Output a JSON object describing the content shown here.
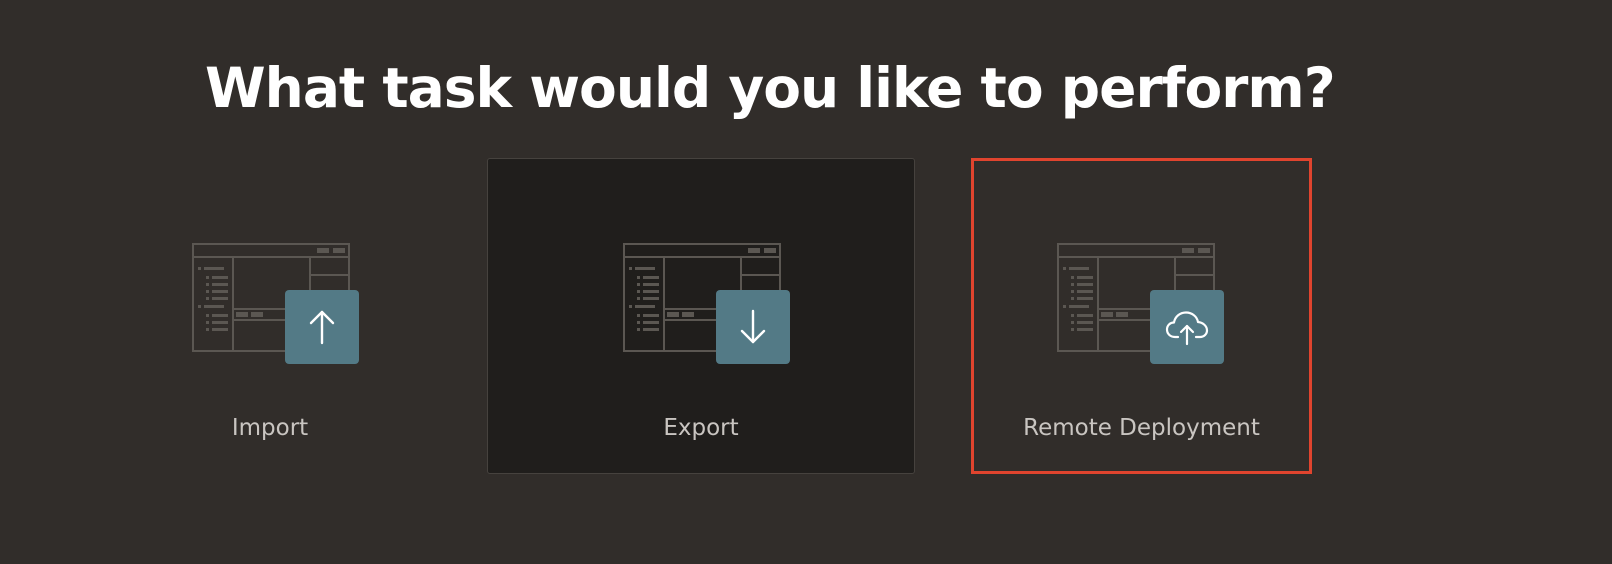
{
  "page": {
    "title": "What task would you like to perform?"
  },
  "tasks": [
    {
      "label": "Import",
      "icon": "upload-arrow-icon",
      "state": "default"
    },
    {
      "label": "Export",
      "icon": "download-arrow-icon",
      "state": "selected"
    },
    {
      "label": "Remote Deployment",
      "icon": "cloud-upload-icon",
      "state": "highlighted"
    }
  ],
  "colors": {
    "background": "#312d2a",
    "selected_card": "#201e1c",
    "tile": "#537a86",
    "highlight": "#e0442e",
    "title": "#ffffff",
    "label": "#c9c5c1"
  }
}
